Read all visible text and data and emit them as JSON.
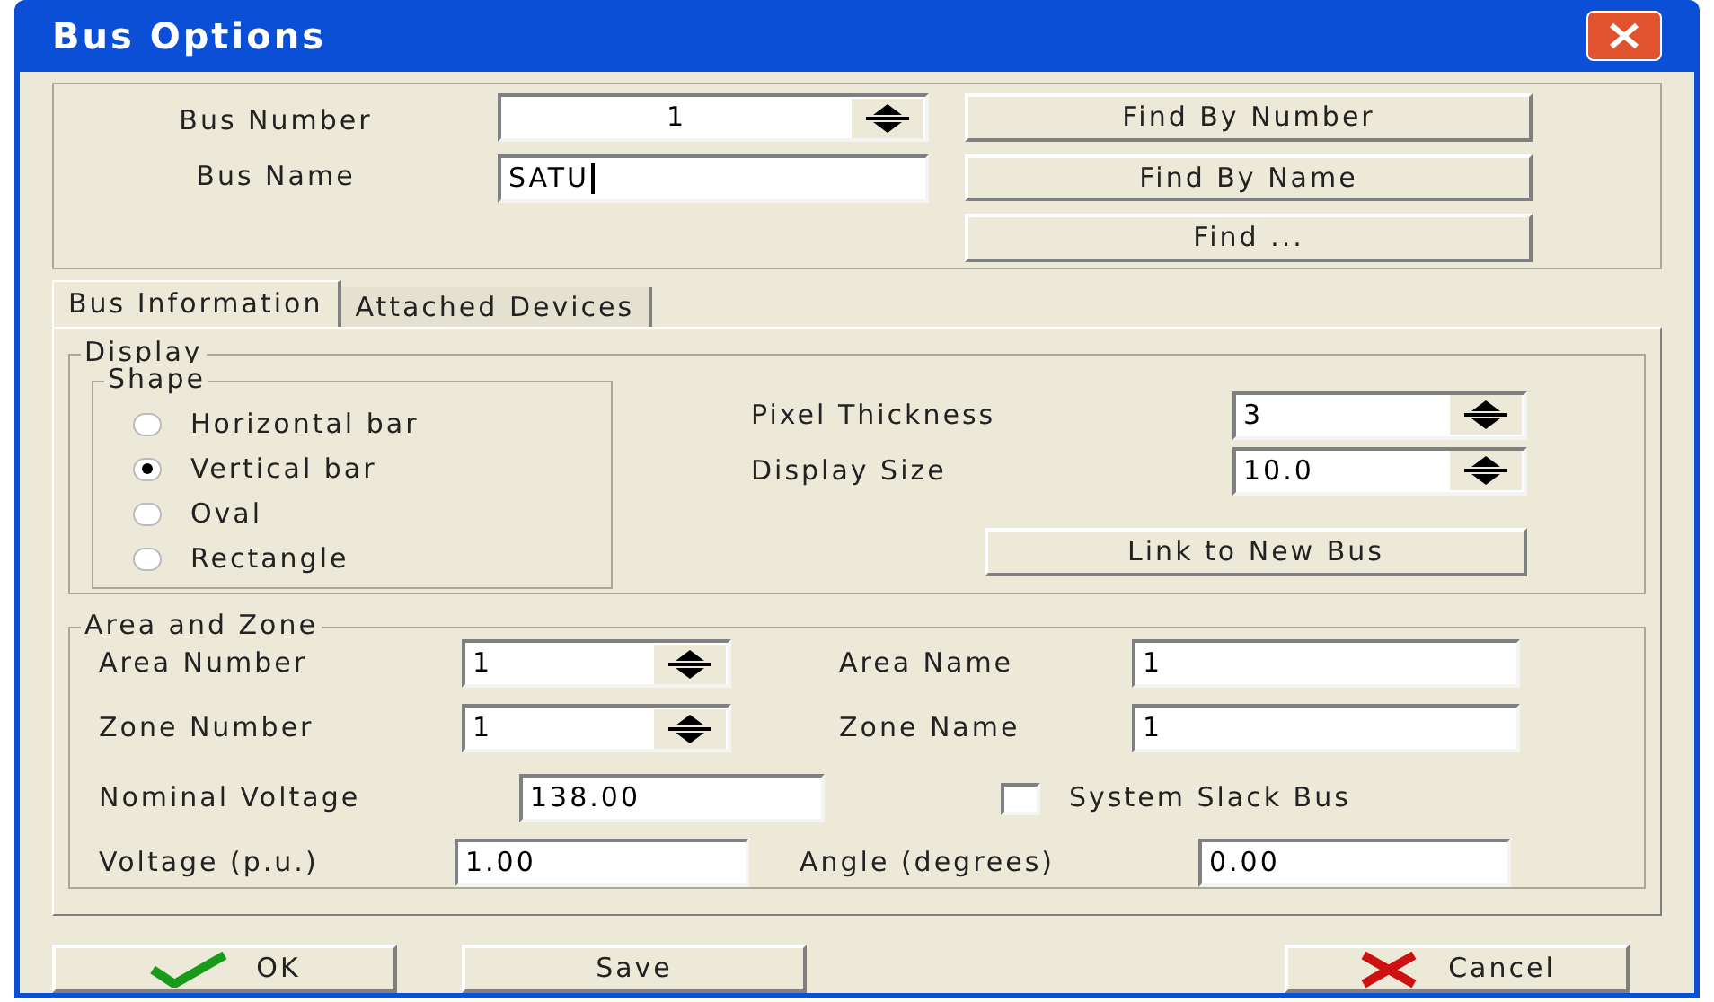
{
  "window": {
    "title": "Bus Options"
  },
  "bus_number": {
    "label": "Bus Number",
    "value": "1"
  },
  "bus_name": {
    "label": "Bus Name",
    "value": "SATU"
  },
  "find_buttons": [
    "Find By Number",
    "Find By Name",
    "Find ..."
  ],
  "tabs": [
    {
      "label": "Bus Information",
      "selected": true
    },
    {
      "label": "Attached Devices",
      "selected": false
    }
  ],
  "display": {
    "legend": "Display",
    "shape": {
      "legend": "Shape",
      "options": [
        {
          "label": "Horizontal bar",
          "selected": false
        },
        {
          "label": "Vertical bar",
          "selected": true
        },
        {
          "label": "Oval",
          "selected": false
        },
        {
          "label": "Rectangle",
          "selected": false
        }
      ]
    },
    "pixel_thickness": {
      "label": "Pixel Thickness",
      "value": "3"
    },
    "display_size": {
      "label": "Display Size",
      "value": "10.0"
    },
    "link_button": "Link to New Bus"
  },
  "area_zone": {
    "legend": "Area and Zone",
    "area_number": {
      "label": "Area Number",
      "value": "1"
    },
    "area_name": {
      "label": "Area Name",
      "value": "1"
    },
    "zone_number": {
      "label": "Zone Number",
      "value": "1"
    },
    "zone_name": {
      "label": "Zone Name",
      "value": "1"
    },
    "nominal_voltage": {
      "label": "Nominal Voltage",
      "value": "138.00"
    },
    "slack": {
      "label": "System Slack Bus",
      "checked": false
    },
    "voltage_pu": {
      "label": "Voltage (p.u.)",
      "value": "1.00"
    },
    "angle": {
      "label": "Angle (degrees)",
      "value": "0.00"
    }
  },
  "buttons": [
    {
      "label": "OK",
      "kind": "ok"
    },
    {
      "label": "Save",
      "kind": "plain"
    },
    {
      "label": "Cancel",
      "kind": "cancel"
    }
  ]
}
